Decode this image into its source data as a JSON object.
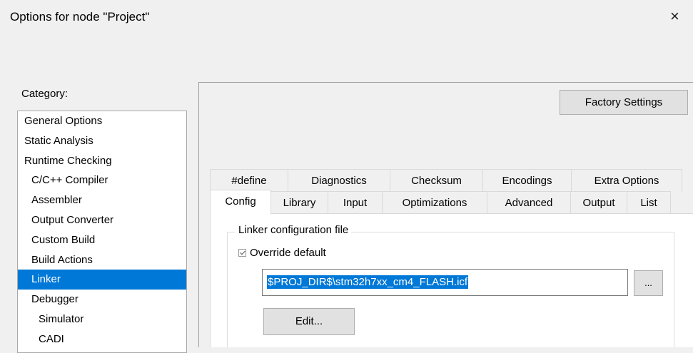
{
  "dialog": {
    "title": "Options for node \"Project\"",
    "close_label": "×"
  },
  "category": {
    "label": "Category:",
    "items": [
      {
        "label": "General Options",
        "indent": 0
      },
      {
        "label": "Static Analysis",
        "indent": 0
      },
      {
        "label": "Runtime Checking",
        "indent": 0
      },
      {
        "label": "C/C++ Compiler",
        "indent": 1
      },
      {
        "label": "Assembler",
        "indent": 1
      },
      {
        "label": "Output Converter",
        "indent": 1
      },
      {
        "label": "Custom Build",
        "indent": 1
      },
      {
        "label": "Build Actions",
        "indent": 1
      },
      {
        "label": "Linker",
        "indent": 1,
        "selected": true
      },
      {
        "label": "Debugger",
        "indent": 1
      },
      {
        "label": "Simulator",
        "indent": 2
      },
      {
        "label": "CADI",
        "indent": 2
      }
    ]
  },
  "factory_settings_label": "Factory Settings",
  "tabs": {
    "row1": [
      "#define",
      "Diagnostics",
      "Checksum",
      "Encodings",
      "Extra Options"
    ],
    "row2": [
      "Config",
      "Library",
      "Input",
      "Optimizations",
      "Advanced",
      "Output",
      "List"
    ],
    "active": "Config"
  },
  "linker_config": {
    "group_title": "Linker configuration file",
    "override_label": "Override default",
    "override_checked": true,
    "path_value": "$PROJ_DIR$\\stm32h7xx_cm4_FLASH.icf",
    "browse_label": "...",
    "edit_label": "Edit..."
  },
  "colors": {
    "selection": "#0078d7",
    "dialog_bg": "#f0f0f0"
  }
}
